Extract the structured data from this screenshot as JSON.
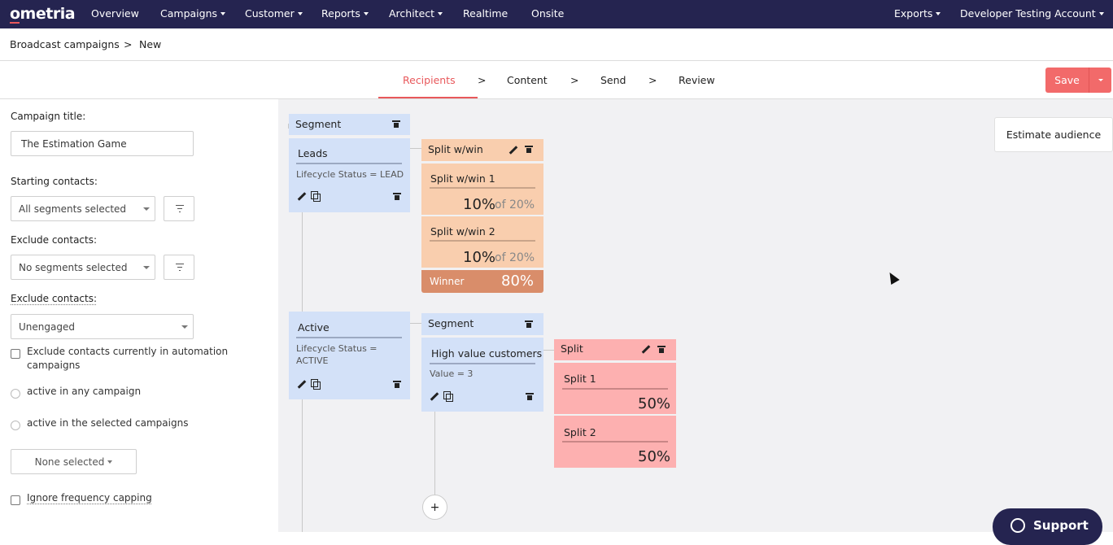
{
  "app": {
    "logo": "ometria"
  },
  "nav": {
    "items": [
      {
        "label": "Overview",
        "has_menu": false
      },
      {
        "label": "Campaigns",
        "has_menu": true
      },
      {
        "label": "Customer",
        "has_menu": true
      },
      {
        "label": "Reports",
        "has_menu": true
      },
      {
        "label": "Architect",
        "has_menu": true
      },
      {
        "label": "Realtime",
        "has_menu": false
      },
      {
        "label": "Onsite",
        "has_menu": false
      }
    ],
    "exports": "Exports",
    "account": "Developer Testing Account"
  },
  "breadcrumb": {
    "parent": "Broadcast campaigns",
    "sep": ">",
    "current": "New"
  },
  "steps": {
    "items": [
      "Recipients",
      "Content",
      "Send",
      "Review"
    ],
    "sep": ">",
    "active": "Recipients"
  },
  "save": {
    "label": "Save"
  },
  "sidebar": {
    "campaign_title_label": "Campaign title:",
    "campaign_title_value": "The Estimation Game",
    "starting_label": "Starting contacts:",
    "starting_value": "All segments selected",
    "exclude_label": "Exclude contacts:",
    "exclude_value": "No segments selected",
    "exclude2_label": "Exclude contacts:",
    "exclude2_value": "Unengaged",
    "exclude_automation": "Exclude contacts currently in automation campaigns",
    "radio_any": "active in any campaign",
    "radio_selected": "active in the selected campaigns",
    "none_selected": "None selected",
    "ignore_freq": "Ignore frequency capping"
  },
  "canvas": {
    "segment1": {
      "title": "Segment",
      "leads": {
        "name": "Leads",
        "condition": "Lifecycle Status = LEAD"
      },
      "active": {
        "name": "Active",
        "condition": "Lifecycle Status = ACTIVE"
      }
    },
    "split_win": {
      "title": "Split w/win",
      "split1": {
        "name": "Split w/win 1",
        "pct": "10%",
        "of": "of 20%"
      },
      "split2": {
        "name": "Split w/win 2",
        "pct": "10%",
        "of": "of 20%"
      },
      "winner": {
        "label": "Winner",
        "pct": "80%"
      }
    },
    "segment2": {
      "title": "Segment",
      "hv": {
        "name": "High value customers",
        "condition": "Value = 3"
      }
    },
    "split": {
      "title": "Split",
      "split1": {
        "name": "Split 1",
        "pct": "50%"
      },
      "split2": {
        "name": "Split 2",
        "pct": "50%"
      }
    },
    "estimate": "Estimate audience",
    "add": "+"
  },
  "support": {
    "label": "Support"
  },
  "colors": {
    "nav_bg": "#252450",
    "accent": "#e8585b",
    "segment_blue": "#d3e1f8",
    "split_win_orange": "#f9ceae",
    "winner_bar": "#d98d6a",
    "split_pink": "#fdb0b0"
  }
}
